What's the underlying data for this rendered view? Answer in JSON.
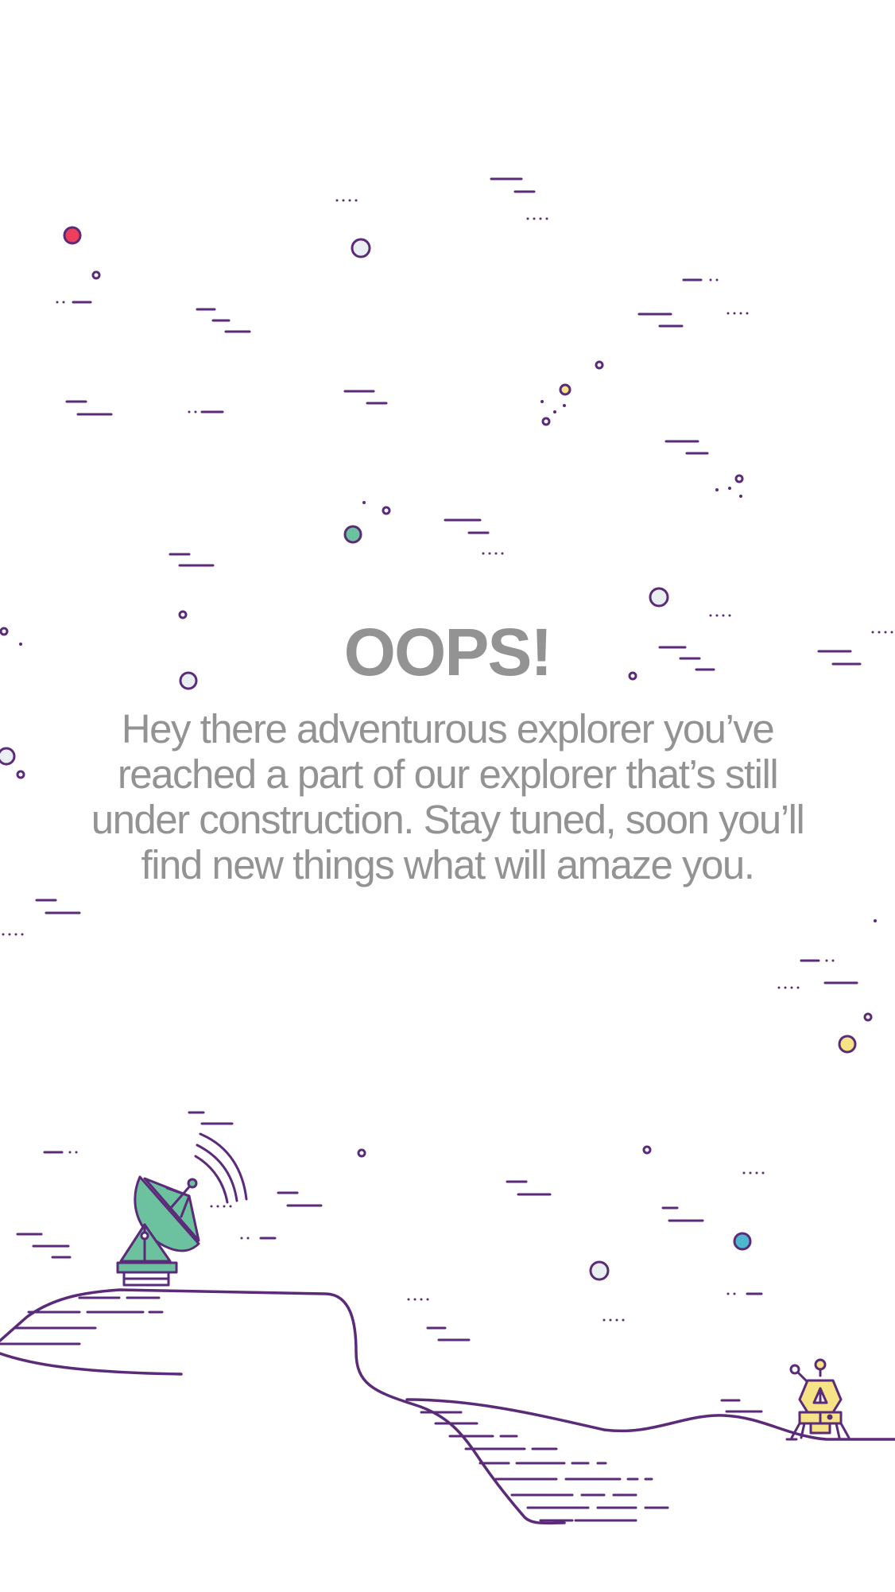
{
  "message": {
    "title": "OOPS!",
    "body": "Hey there adventurous explorer you’ve reached a part of our explorer that’s still under construction. Stay tuned, soon you’ll find new things what will amaze you."
  },
  "colors": {
    "text": "#939393",
    "line": "#5b2a79",
    "dish_green": "#6cc19e",
    "star_red": "#ef3e5c",
    "star_yellow": "#f6e386",
    "star_blue": "#4fb6cf",
    "star_pale": "#e8eef2",
    "lander_yellow": "#f6e386"
  },
  "illustration": {
    "icons": [
      "satellite-dish-icon",
      "lunar-lander-icon",
      "hill-outline",
      "crater-outline",
      "star-dots",
      "dash-marks"
    ]
  }
}
